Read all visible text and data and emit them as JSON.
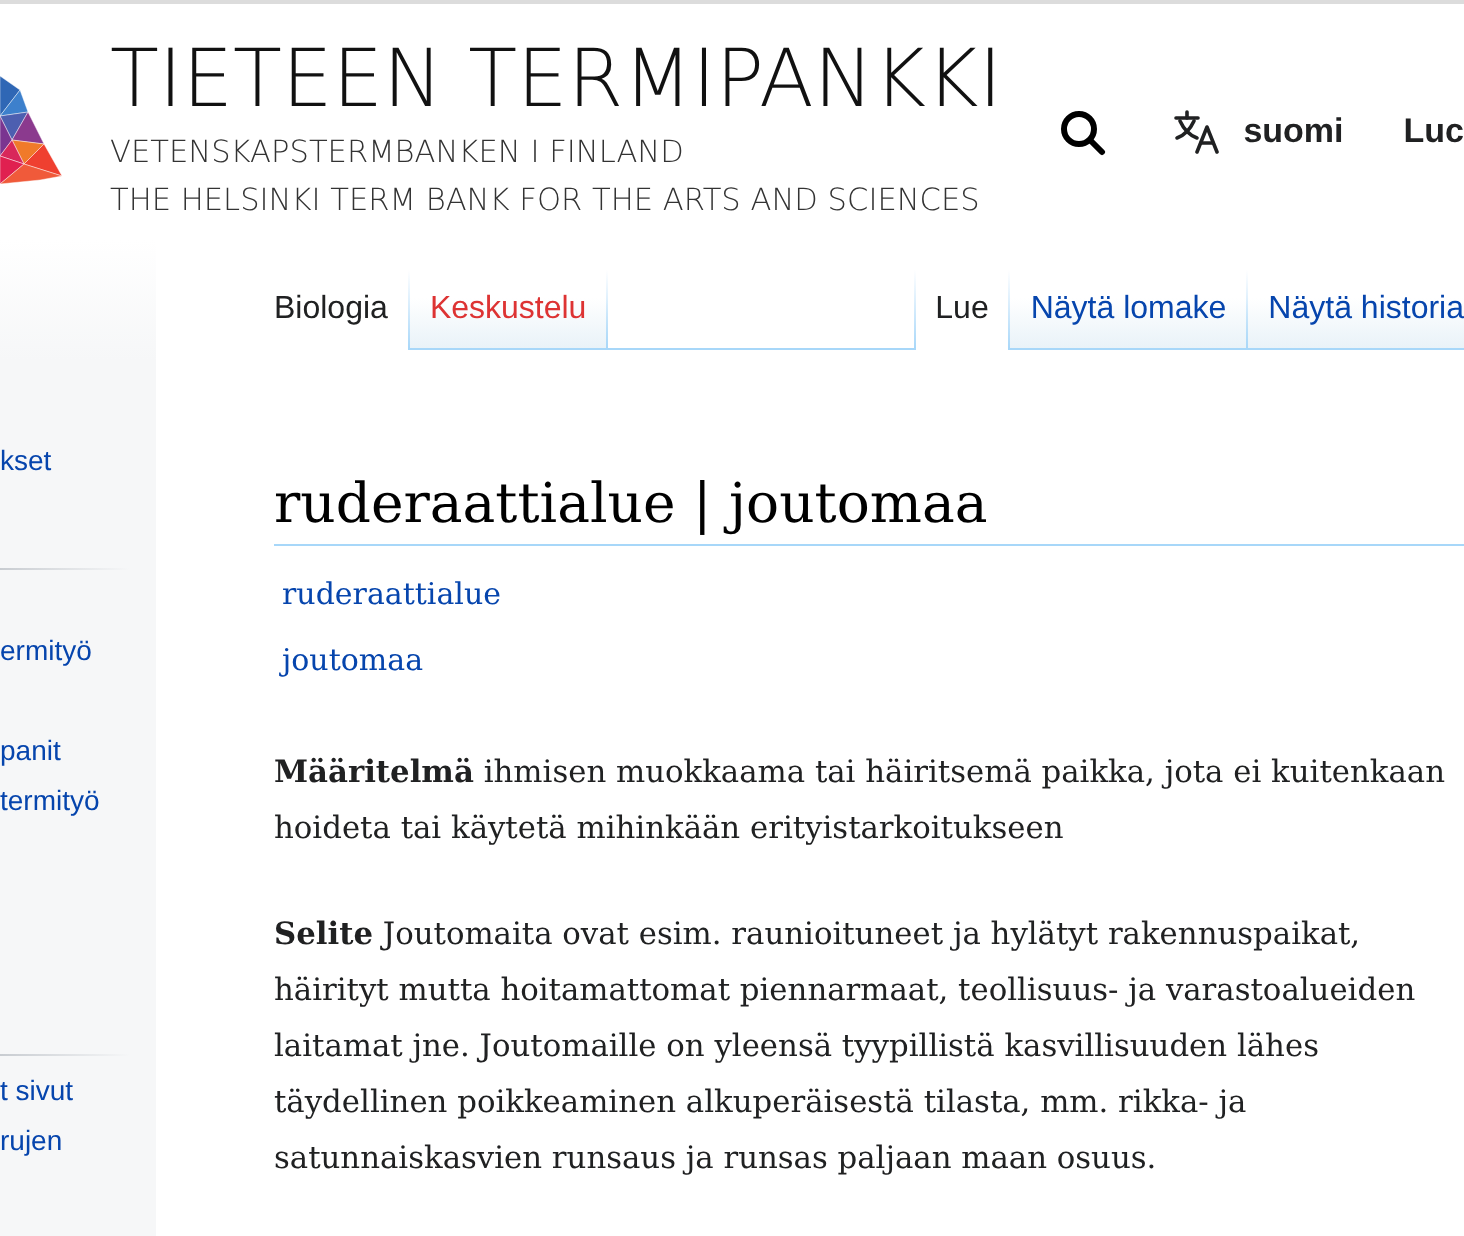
{
  "header": {
    "title": "TIETEEN TERMIPANKKI",
    "subtitles": [
      "VETENSKAPSTERMBANKEN I FINLAND",
      "THE HELSINKI TERM BANK FOR THE ARTS AND SCIENCES"
    ]
  },
  "user_nav": {
    "language": "suomi",
    "links": [
      "Luc"
    ]
  },
  "sidebar": {
    "sections": [
      {
        "items": [
          "kset"
        ]
      },
      {
        "items": [
          "ermityö",
          "panit",
          "termityö"
        ]
      },
      {
        "items": [
          "t sivut",
          "rujen"
        ]
      }
    ]
  },
  "namespace_tabs": [
    {
      "label": "Biologia",
      "selected": true,
      "missing": false
    },
    {
      "label": "Keskustelu",
      "selected": false,
      "missing": true
    }
  ],
  "view_tabs": [
    {
      "label": "Lue",
      "selected": true
    },
    {
      "label": "Näytä lomake",
      "selected": false
    },
    {
      "label": "Näytä historia",
      "selected": false
    }
  ],
  "article": {
    "heading": "ruderaattialue | joutomaa",
    "terms": [
      "ruderaattialue",
      "joutomaa"
    ],
    "paragraphs": [
      "**Määritelmä** ihmisen muokkaama tai häiritsemä paikka, jota ei kuitenkaan hoideta tai käytetä mihinkään erityistarkoitukseen",
      "**Selite** Joutomaita ovat esim. raunioituneet ja hylätyt rakennuspaikat, häirityt mutta hoitamattomat piennarmaat, teollisuus- ja varastoalueiden laitamat jne. Joutomaille on yleensä tyypillistä kasvillisuuden lähes täydellinen poikkeaminen alkuperäisestä tilasta, mm. rikka- ja satunnaiskasvien runsaus ja runsas paljaan maan osuus."
    ]
  }
}
